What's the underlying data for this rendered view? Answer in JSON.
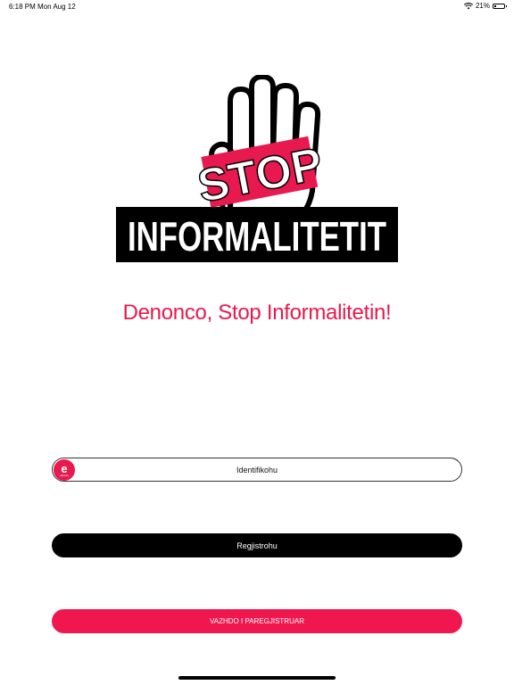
{
  "status_bar": {
    "time": "6:18 PM",
    "date": "Mon Aug 12",
    "battery_text": "21%",
    "battery_level": 0.21,
    "wifi_icon": "wifi-icon",
    "battery_icon": "battery-icon"
  },
  "logo": {
    "stop_text": "STOP",
    "informal_text": "INFORMALITETIT",
    "icon": "raised-hand-icon",
    "colors": {
      "red": "#e8194f",
      "black": "#000000"
    }
  },
  "tagline": "Denonco, Stop Informalitetin!",
  "buttons": {
    "identify_label": "Identifikohu",
    "identify_icon_letter": "e",
    "identify_icon_sub": "albania",
    "register_label": "Regjistrohu",
    "continue_label": "VAZHDO I PAREGJISTRUAR"
  },
  "colors": {
    "accent": "#e8194f",
    "dark": "#000000"
  }
}
